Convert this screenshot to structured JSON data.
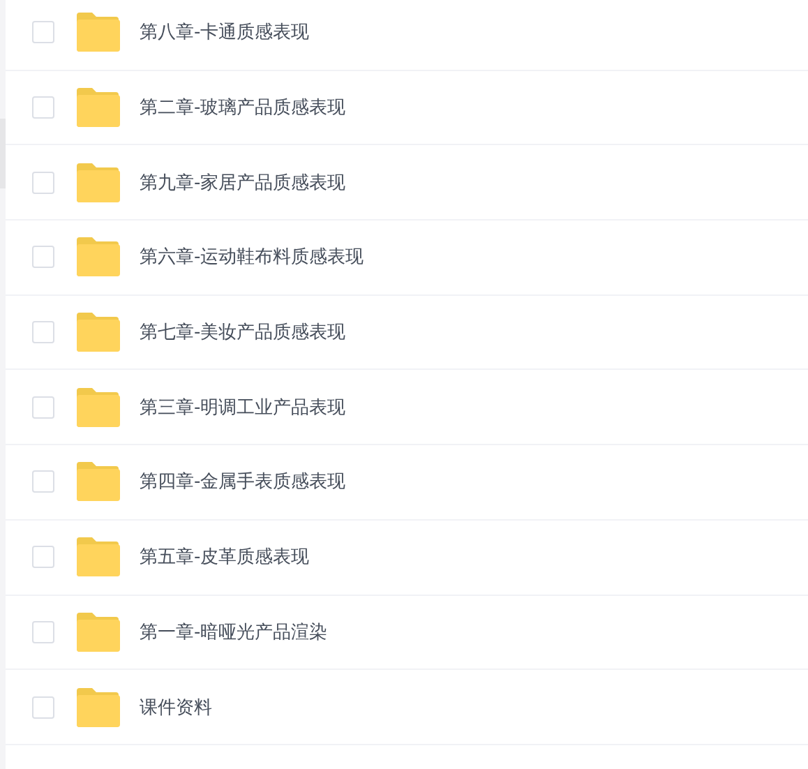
{
  "files": [
    {
      "name": "第八章-卡通质感表现",
      "checked": false
    },
    {
      "name": "第二章-玻璃产品质感表现",
      "checked": false
    },
    {
      "name": "第九章-家居产品质感表现",
      "checked": false
    },
    {
      "name": "第六章-运动鞋布料质感表现",
      "checked": false
    },
    {
      "name": "第七章-美妆产品质感表现",
      "checked": false
    },
    {
      "name": "第三章-明调工业产品表现",
      "checked": false
    },
    {
      "name": "第四章-金属手表质感表现",
      "checked": false
    },
    {
      "name": "第五章-皮革质感表现",
      "checked": false
    },
    {
      "name": "第一章-暗哑光产品渲染",
      "checked": false
    },
    {
      "name": "课件资料",
      "checked": false
    }
  ]
}
